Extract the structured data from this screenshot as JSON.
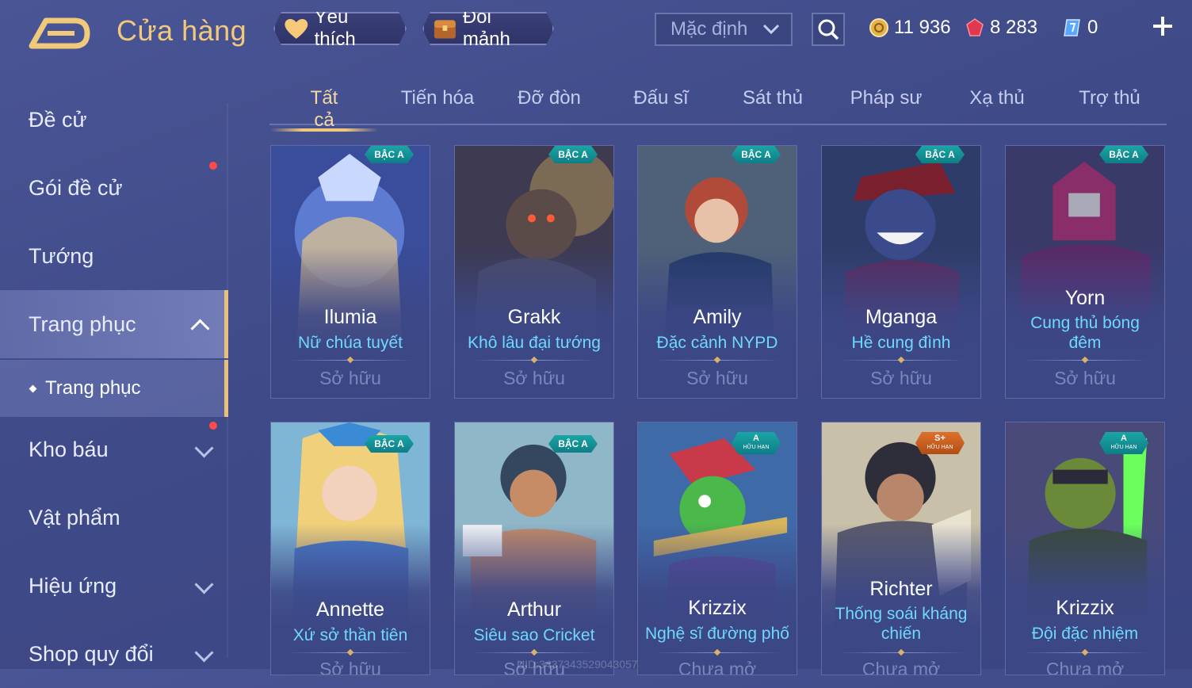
{
  "header": {
    "title": "Cửa hàng",
    "favorites_label": "Yêu thích",
    "exchange_label": "Đổi mảnh",
    "sort_selected": "Mặc định",
    "currencies": {
      "gold": "11 936",
      "ruby": "8 283",
      "voucher": "0"
    }
  },
  "sidebar": {
    "items": [
      {
        "label": "Đề cử"
      },
      {
        "label": "Gói đề cử"
      },
      {
        "label": "Tướng"
      },
      {
        "label": "Trang phục"
      },
      {
        "label": "Trang phục"
      },
      {
        "label": "Kho báu"
      },
      {
        "label": "Vật phẩm"
      },
      {
        "label": "Hiệu ứng"
      },
      {
        "label": "Shop quy đổi"
      }
    ]
  },
  "tabs": [
    "Tất cả",
    "Tiến hóa",
    "Đỡ đòn",
    "Đấu sĩ",
    "Sát thủ",
    "Pháp sư",
    "Xạ thủ",
    "Trợ thủ"
  ],
  "cards": [
    {
      "hero": "Ilumia",
      "skin": "Nữ chúa tuyết",
      "status": "Sở hữu",
      "tier": "BẬC A",
      "tier_note": ""
    },
    {
      "hero": "Grakk",
      "skin": "Khô lâu đại tướng",
      "status": "Sở hữu",
      "tier": "BẬC A",
      "tier_note": ""
    },
    {
      "hero": "Amily",
      "skin": "Đặc cảnh NYPD",
      "status": "Sở hữu",
      "tier": "BẬC A",
      "tier_note": ""
    },
    {
      "hero": "Mganga",
      "skin": "Hề cung đình",
      "status": "Sở hữu",
      "tier": "BẬC A",
      "tier_note": ""
    },
    {
      "hero": "Yorn",
      "skin": "Cung thủ bóng",
      "skin2": "đêm",
      "status": "Sở hữu",
      "tier": "BẬC A",
      "tier_note": ""
    },
    {
      "hero": "Annette",
      "skin": "Xứ sở thần tiên",
      "status": "Sở hữu",
      "tier": "BẬC A",
      "tier_note": ""
    },
    {
      "hero": "Arthur",
      "skin": "Siêu sao Cricket",
      "status": "Sở hữu",
      "tier": "BẬC A",
      "tier_note": ""
    },
    {
      "hero": "Krizzix",
      "skin": "Nghệ sĩ đường phố",
      "status": "Chưa mở",
      "tier": "A",
      "tier_note": "HỮU HẠN"
    },
    {
      "hero": "Richter",
      "skin": "Thống soái kháng",
      "skin2": "chiến",
      "status": "Chưa mở",
      "tier": "S+",
      "tier_note": "HỮU HẠN"
    },
    {
      "hero": "Krizzix",
      "skin": "Đội đặc nhiệm",
      "status": "Chưa mở",
      "tier": "A",
      "tier_note": "HỮU HẠN"
    }
  ],
  "watermark": "UID:3437343529043057",
  "colors": {
    "accent_gold": "#f0c97a",
    "skin_name": "#6ed8ff",
    "tier_teal": "#1aa6a6",
    "tier_orange": "#e0702a",
    "notification": "#ff4a4a"
  }
}
